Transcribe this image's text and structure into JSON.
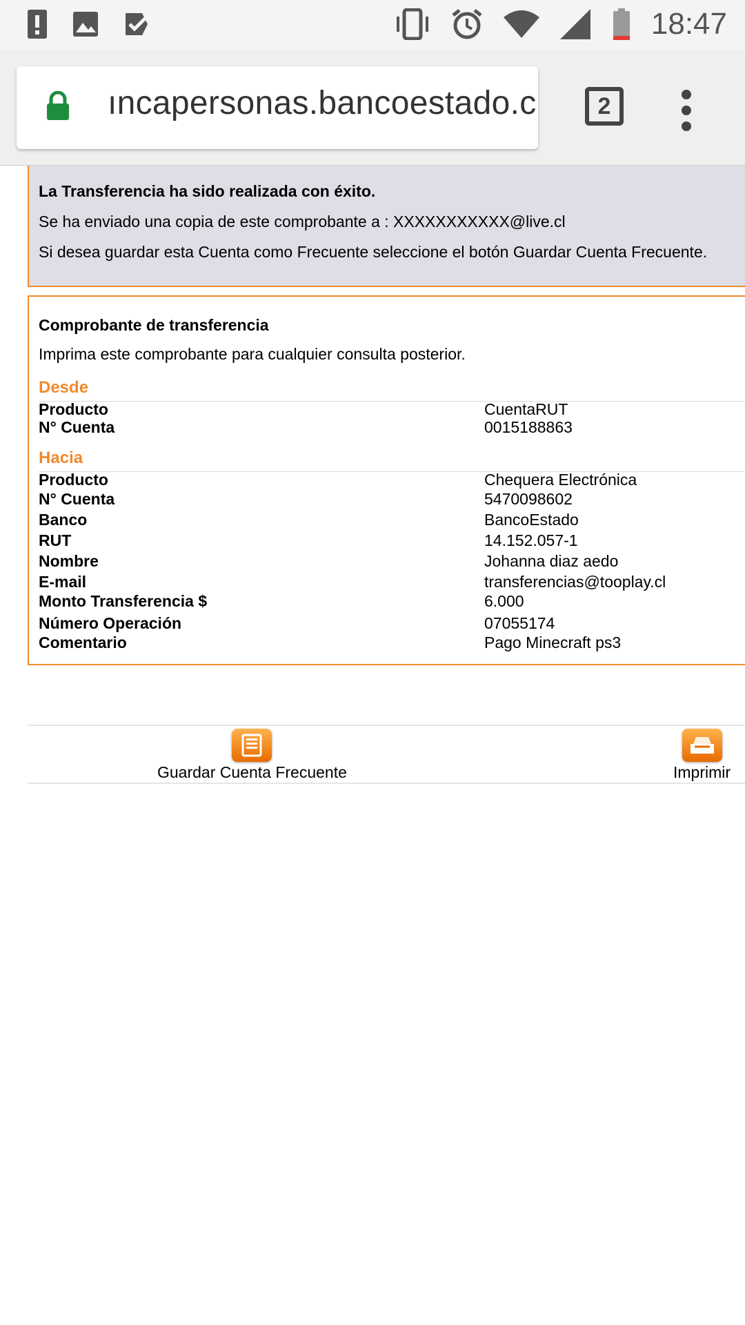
{
  "status_bar": {
    "time": "18:47",
    "icons": [
      "alert-icon",
      "image-icon",
      "task-check-icon",
      "vibrate-icon",
      "alarm-icon",
      "wifi-icon",
      "signal-icon",
      "battery-icon"
    ]
  },
  "browser": {
    "url": "ıncapersonas.bancoestado.cl",
    "tab_count": "2"
  },
  "success": {
    "title": "La Transferencia ha sido realizada con éxito.",
    "copy_line": "Se ha enviado una copia de este comprobante a : XXXXXXXXXXX@live.cl",
    "frequent_line": "Si desea guardar esta Cuenta como Frecuente seleccione el botón Guardar Cuenta Frecuente."
  },
  "receipt": {
    "title": "Comprobante de transferencia",
    "subtitle": "Imprima este comprobante para cualquier consulta posterior.",
    "desde": {
      "label": "Desde",
      "rows": [
        {
          "k": "Producto",
          "v": "CuentaRUT"
        },
        {
          "k": "N° Cuenta",
          "v": "0015188863"
        }
      ]
    },
    "hacia": {
      "label": "Hacia",
      "rows": [
        {
          "k": "Producto",
          "v": "Chequera Electrónica"
        },
        {
          "k": "N° Cuenta",
          "v": "5470098602"
        },
        {
          "k": "Banco",
          "v": "BancoEstado"
        },
        {
          "k": "RUT",
          "v": "14.152.057-1"
        },
        {
          "k": "Nombre",
          "v": "Johanna diaz aedo"
        },
        {
          "k": "E-mail",
          "v": "transferencias@tooplay.cl"
        },
        {
          "k": "Monto Transferencia $",
          "v": "6.000"
        },
        {
          "k": "Número Operación",
          "v": "07055174"
        },
        {
          "k": "Comentario",
          "v": "Pago Minecraft ps3"
        }
      ]
    }
  },
  "actions": {
    "save_label": "Guardar Cuenta Frecuente",
    "print_label": "Imprimir"
  },
  "colors": {
    "accent": "#f08a2b",
    "success_bg": "#dedee6",
    "lock_green": "#1e8e3e"
  }
}
